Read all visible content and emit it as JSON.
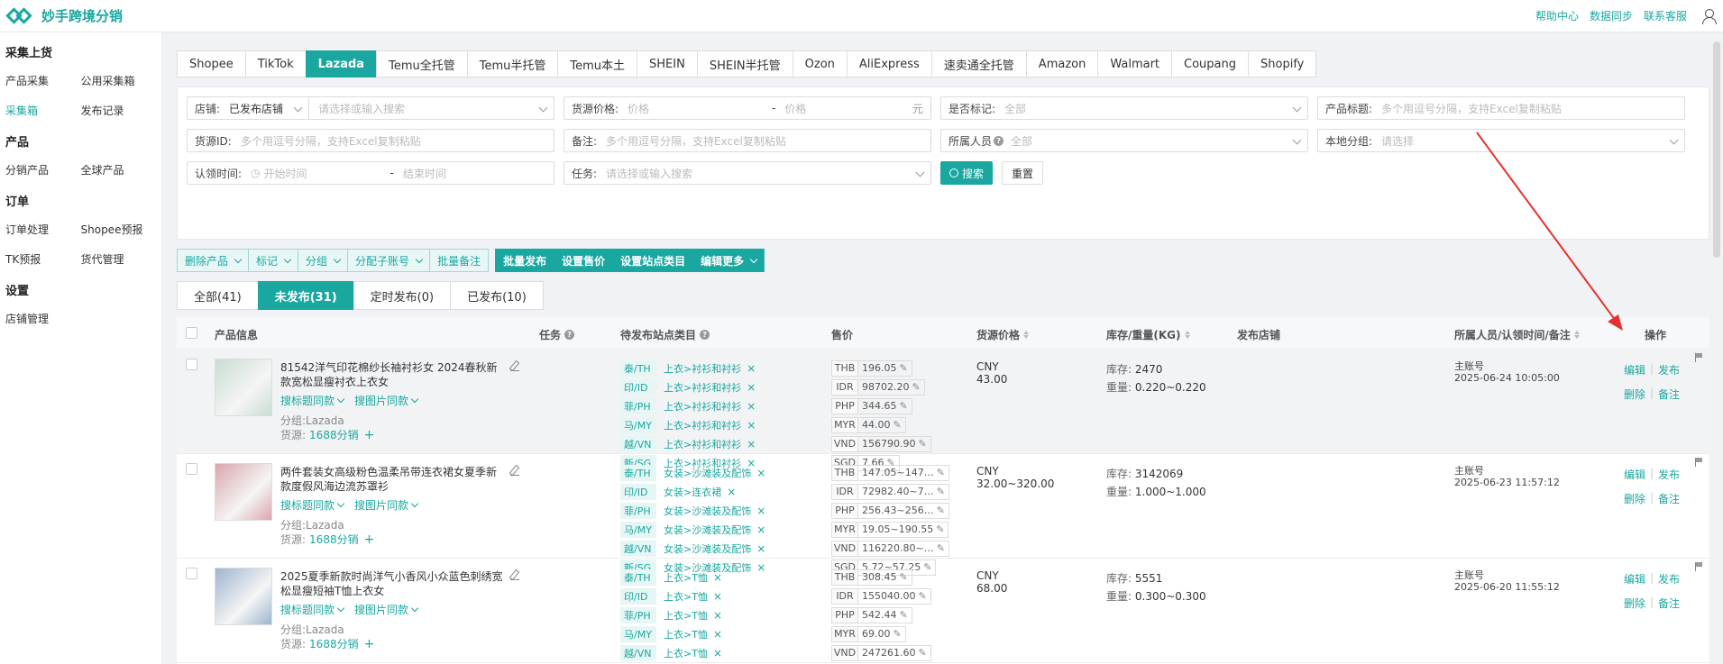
{
  "app": {
    "name": "妙手跨境分销"
  },
  "top_links": [
    "帮助中心",
    "数据同步",
    "联系客服"
  ],
  "sidebar": {
    "groups": [
      {
        "title": "采集上货",
        "rows": [
          [
            "产品采集",
            "公用采集箱"
          ],
          [
            "采集箱",
            "发布记录"
          ]
        ]
      },
      {
        "title": "产品",
        "rows": [
          [
            "分销产品",
            "全球产品"
          ]
        ]
      },
      {
        "title": "订单",
        "rows": [
          [
            "订单处理",
            "Shopee预报"
          ],
          [
            "TK预报",
            "货代管理"
          ]
        ]
      },
      {
        "title": "设置",
        "rows": [
          [
            "店铺管理"
          ]
        ]
      }
    ],
    "active": "采集箱"
  },
  "platform_tabs": [
    "Shopee",
    "TikTok",
    "Lazada",
    "Temu全托管",
    "Temu半托管",
    "Temu本土",
    "SHEIN",
    "SHEIN半托管",
    "Ozon",
    "AliExpress",
    "速卖通全托管",
    "Amazon",
    "Walmart",
    "Coupang",
    "Shopify"
  ],
  "active_platform": "Lazada",
  "filters": {
    "shop_label": "店铺:",
    "shop_value": "已发布店铺",
    "shop_search_ph": "请选择或输入搜索",
    "price_label": "货源价格:",
    "price_min_ph": "价格",
    "price_dash": "-",
    "price_max_ph": "价格",
    "price_unit": "元",
    "marked_label": "是否标记:",
    "marked_value": "全部",
    "title_label": "产品标题:",
    "title_ph": "多个用逗号分隔，支持Excel复制粘贴",
    "source_id_label": "货源ID:",
    "source_id_ph": "多个用逗号分隔，支持Excel复制粘贴",
    "note_label": "备注:",
    "note_ph": "多个用逗号分隔，支持Excel复制粘贴",
    "owner_label": "所属人员",
    "owner_value": "全部",
    "group_label": "本地分组:",
    "group_ph": "请选择",
    "claim_label": "认领时间:",
    "claim_start_ph": "开始时间",
    "claim_dash": "-",
    "claim_end_ph": "结束时间",
    "task_label": "任务:",
    "task_ph": "请选择或输入搜索",
    "search_btn": "搜索",
    "reset_btn": "重置"
  },
  "actions": {
    "group1": [
      "删除产品",
      "标记",
      "分组",
      "分配子账号"
    ],
    "batch_note": "批量备注",
    "group2": [
      "批量发布",
      "设置售价",
      "设置站点类目",
      "编辑更多"
    ]
  },
  "status_tabs": [
    "全部(41)",
    "未发布(31)",
    "定时发布(0)",
    "已发布(10)"
  ],
  "active_status": "未发布(31)",
  "columns": {
    "product": "产品信息",
    "task": "任务",
    "category": "待发布站点类目",
    "price": "售价",
    "source_price": "货源价格",
    "stock": "库存/重量(KG)",
    "shop": "发布店铺",
    "owner": "所属人员/认领时间/备注",
    "ops": "操作"
  },
  "row_labels": {
    "search_title": "搜标题同款",
    "search_image": "搜图片同款",
    "group_prefix": "分组:",
    "source_prefix": "货源:",
    "source_name": "1688分销",
    "add": "+",
    "stock_prefix": "库存:",
    "weight_prefix": "重量:",
    "edit": "编辑",
    "publish": "发布",
    "delete": "删除",
    "note": "备注",
    "sep": "|",
    "x": "×"
  },
  "rows": [
    {
      "title": "81542洋气印花棉纱长袖衬衫女 2024春秋新款宽松显瘦衬衣上衣女",
      "group": "Lazada",
      "thumb_color": "#c9ddd3",
      "categories": [
        [
          "泰/TH",
          "上衣>衬衫和衬衫"
        ],
        [
          "印/ID",
          "上衣>衬衫和衬衫"
        ],
        [
          "菲/PH",
          "上衣>衬衫和衬衫"
        ],
        [
          "马/MY",
          "上衣>衬衫和衬衫"
        ],
        [
          "越/VN",
          "上衣>衬衫和衬衫"
        ],
        [
          "新/SG",
          "上衣>衬衫和衬衫"
        ]
      ],
      "prices": [
        [
          "THB",
          "196.05"
        ],
        [
          "IDR",
          "98702.20"
        ],
        [
          "PHP",
          "344.65"
        ],
        [
          "MYR",
          "44.00"
        ],
        [
          "VND",
          "156790.90"
        ],
        [
          "SGD",
          "7.66"
        ]
      ],
      "source_cur": "CNY",
      "source_price": "43.00",
      "stock": "2470",
      "weight": "0.220~0.220",
      "owner": "主账号",
      "time": "2025-06-24 10:05:00"
    },
    {
      "title": "两件套装女高级粉色温柔吊带连衣裙女夏季新款度假风海边流苏罩衫",
      "group": "Lazada",
      "thumb_color": "#d9a6ad",
      "categories": [
        [
          "泰/TH",
          "女装>沙滩装及配饰"
        ],
        [
          "印/ID",
          "女装>连衣裙"
        ],
        [
          "菲/PH",
          "女装>沙滩装及配饰"
        ],
        [
          "马/MY",
          "女装>沙滩装及配饰"
        ],
        [
          "越/VN",
          "女装>沙滩装及配饰"
        ],
        [
          "新/SG",
          "女装>沙滩装及配饰"
        ]
      ],
      "prices": [
        [
          "THB",
          "147.05~147…"
        ],
        [
          "IDR",
          "72982.40~7…"
        ],
        [
          "PHP",
          "256.43~256…"
        ],
        [
          "MYR",
          "19.05~190.55"
        ],
        [
          "VND",
          "116220.80~…"
        ],
        [
          "SGD",
          "5.72~57.25"
        ]
      ],
      "source_cur": "CNY",
      "source_price": "32.00~320.00",
      "stock": "3142069",
      "weight": "1.000~1.000",
      "owner": "主账号",
      "time": "2025-06-23 11:57:12"
    },
    {
      "title": "2025夏季新款时尚洋气小香风小众蓝色刺绣宽松显瘦短袖T恤上衣女",
      "group": "Lazada",
      "thumb_color": "#9fb4cf",
      "categories": [
        [
          "泰/TH",
          "上衣>T恤"
        ],
        [
          "印/ID",
          "上衣>T恤"
        ],
        [
          "菲/PH",
          "上衣>T恤"
        ],
        [
          "马/MY",
          "上衣>T恤"
        ],
        [
          "越/VN",
          "上衣>T恤"
        ]
      ],
      "prices": [
        [
          "THB",
          "308.45"
        ],
        [
          "IDR",
          "155040.00"
        ],
        [
          "PHP",
          "542.44"
        ],
        [
          "MYR",
          "69.00"
        ],
        [
          "VND",
          "247261.60"
        ]
      ],
      "source_cur": "CNY",
      "source_price": "68.00",
      "stock": "5551",
      "weight": "0.300~0.300",
      "owner": "主账号",
      "time": "2025-06-20 11:55:12"
    }
  ]
}
